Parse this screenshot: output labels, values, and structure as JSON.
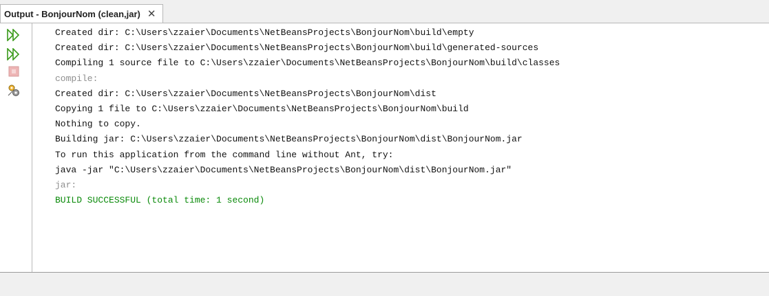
{
  "tab": {
    "title": "Output - BonjourNom (clean,jar)",
    "close_glyph": "✕"
  },
  "gutter_icons": [
    "rerun-icon",
    "rerun-with-params-icon",
    "stop-icon",
    "settings-icon"
  ],
  "colors": {
    "info_text": "#8f8f8f",
    "success_text": "#0a8a0a",
    "normal_text": "#111111"
  },
  "output_lines": [
    {
      "text": "Created dir: C:\\Users\\zzaier\\Documents\\NetBeansProjects\\BonjourNom\\build\\empty",
      "kind": "normal"
    },
    {
      "text": "Created dir: C:\\Users\\zzaier\\Documents\\NetBeansProjects\\BonjourNom\\build\\generated-sources",
      "kind": "normal"
    },
    {
      "text": "Compiling 1 source file to C:\\Users\\zzaier\\Documents\\NetBeansProjects\\BonjourNom\\build\\classes",
      "kind": "normal"
    },
    {
      "text": "compile:",
      "kind": "info"
    },
    {
      "text": "Created dir: C:\\Users\\zzaier\\Documents\\NetBeansProjects\\BonjourNom\\dist",
      "kind": "normal"
    },
    {
      "text": "Copying 1 file to C:\\Users\\zzaier\\Documents\\NetBeansProjects\\BonjourNom\\build",
      "kind": "normal"
    },
    {
      "text": "Nothing to copy.",
      "kind": "normal"
    },
    {
      "text": "Building jar: C:\\Users\\zzaier\\Documents\\NetBeansProjects\\BonjourNom\\dist\\BonjourNom.jar",
      "kind": "normal"
    },
    {
      "text": "To run this application from the command line without Ant, try:",
      "kind": "normal"
    },
    {
      "text": "java -jar \"C:\\Users\\zzaier\\Documents\\NetBeansProjects\\BonjourNom\\dist\\BonjourNom.jar\"",
      "kind": "normal"
    },
    {
      "text": "jar:",
      "kind": "info"
    },
    {
      "text": "BUILD SUCCESSFUL (total time: 1 second)",
      "kind": "success"
    }
  ]
}
